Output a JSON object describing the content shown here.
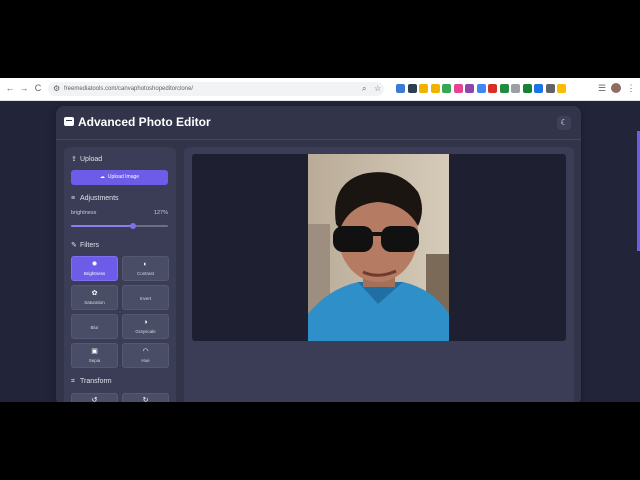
{
  "browser": {
    "url": "freemediatools.com/canvaphotoshopeditorclone/",
    "nav": {
      "back": "←",
      "forward": "→",
      "reload": "C"
    },
    "icons": {
      "site_info": "site-settings-icon",
      "zoom": "zoom-icon",
      "bookmark": "star-icon",
      "menu": "kebab-menu-icon"
    },
    "extensions": [
      "#3a7bd5",
      "#2d3e50",
      "#f0b400",
      "#f0b400",
      "#34a853",
      "#e84393",
      "#8e44ad",
      "#4285f4",
      "#d93025",
      "#1e8e3e",
      "#9aa0a6",
      "#188038",
      "#1a73e8",
      "#5f6368",
      "#fbbc04"
    ]
  },
  "app": {
    "title": "Advanced Photo Editor",
    "theme_toggle_icon": "moon-icon",
    "accent": "#6c5ce7"
  },
  "sidebar": {
    "upload": {
      "title": "Upload",
      "button_label": "Upload Image"
    },
    "adjustments": {
      "title": "Adjustments",
      "label": "brightness",
      "value_text": "127%",
      "value_fraction": 0.64
    },
    "filters": {
      "title": "Filters",
      "items": [
        {
          "label": "Brightness",
          "icon": "sun-icon",
          "active": true
        },
        {
          "label": "Contrast",
          "icon": "contrast-icon",
          "active": false
        },
        {
          "label": "Saturation",
          "icon": "palette-icon",
          "active": false
        },
        {
          "label": "Invert",
          "icon": "",
          "active": false
        },
        {
          "label": "Blur",
          "icon": "",
          "active": false
        },
        {
          "label": "Grayscale",
          "icon": "halftone-icon",
          "active": false
        },
        {
          "label": "Sepia",
          "icon": "image-icon",
          "active": false
        },
        {
          "label": "Hue",
          "icon": "gauge-icon",
          "active": false
        }
      ]
    },
    "transform": {
      "title": "Transform",
      "buttons": [
        {
          "icon": "rotate-left-icon"
        },
        {
          "icon": "rotate-right-icon"
        }
      ]
    }
  },
  "canvas": {
    "photo_description_icon": "portrait-photo"
  }
}
